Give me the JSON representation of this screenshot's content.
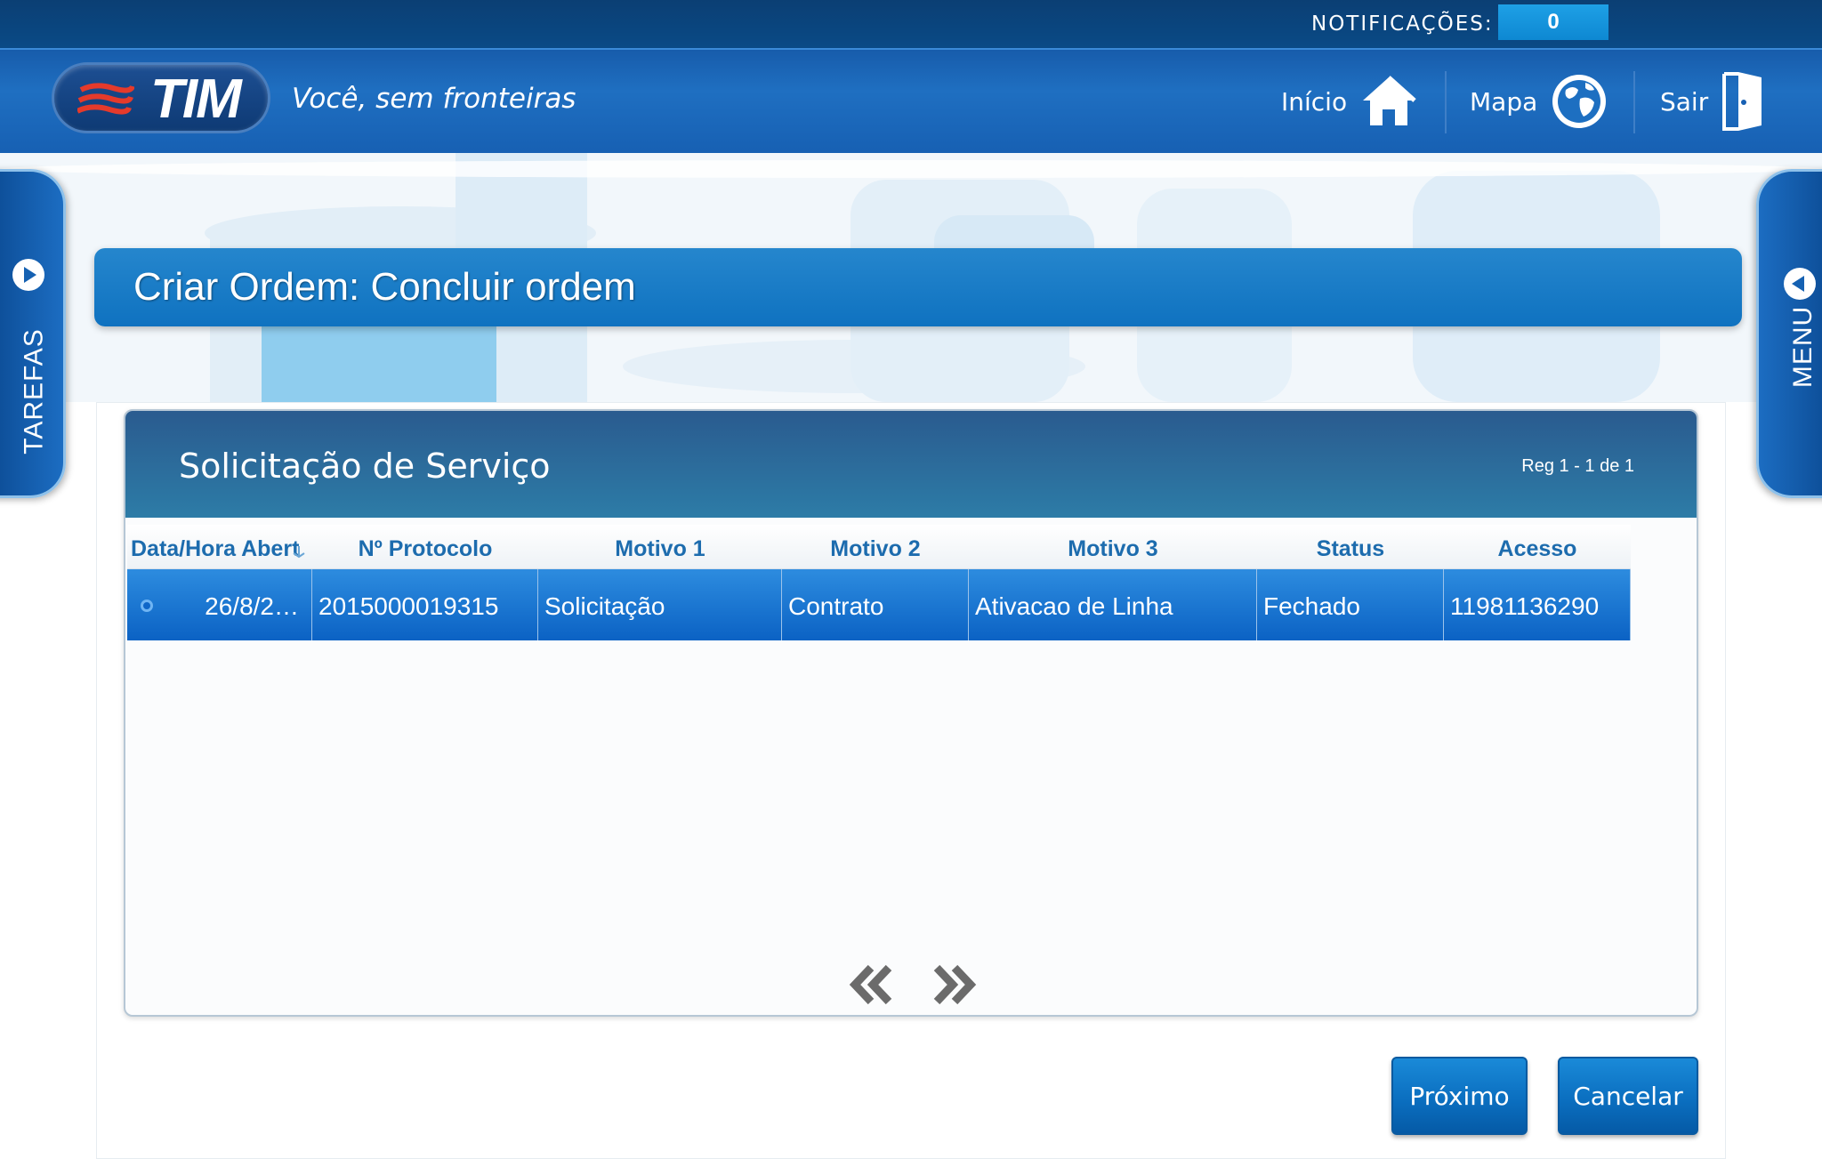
{
  "notifications": {
    "label": "NOTIFICAÇÕES:",
    "count": "0"
  },
  "header": {
    "logo_text": "TIM",
    "tagline": "Você, sem fronteiras",
    "nav": [
      {
        "label": "Início",
        "icon": "home-icon"
      },
      {
        "label": "Mapa",
        "icon": "globe-icon"
      },
      {
        "label": "Sair",
        "icon": "exit-door-icon"
      }
    ]
  },
  "side_tabs": {
    "left": "TAREFAS",
    "right": "MENU"
  },
  "page_title": "Criar Ordem:  Concluir ordem",
  "card": {
    "title": "Solicitação de Serviço",
    "record_info": "Reg 1 - 1 de 1"
  },
  "table": {
    "columns": [
      "Data/Hora Abert",
      "Nº Protocolo",
      "Motivo 1",
      "Motivo 2",
      "Motivo 3",
      "Status",
      "Acesso"
    ],
    "rows": [
      {
        "selected": true,
        "cells": [
          "26/8/2…",
          "2015000019315",
          "Solicitação",
          "Contrato",
          "Ativacao de Linha",
          "Fechado",
          "11981136290"
        ]
      }
    ]
  },
  "buttons": {
    "next": "Próximo",
    "cancel": "Cancelar"
  },
  "colors": {
    "brand_blue": "#1760b3",
    "title_bar": "#0f72c0",
    "header_text": "#1d6cae",
    "tim_red": "#e53a2b"
  }
}
